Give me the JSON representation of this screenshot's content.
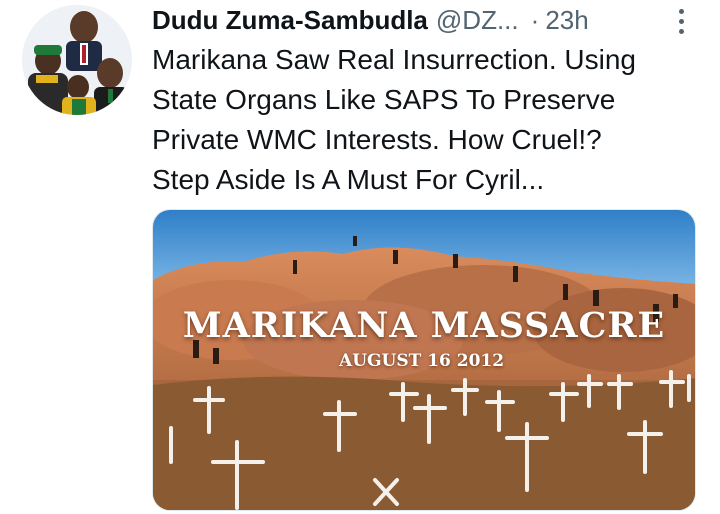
{
  "tweet": {
    "author": {
      "display_name": "Dudu Zuma-Sambudla",
      "handle": "@DZ...",
      "avatar_icon": "profile-avatar"
    },
    "separator": "·",
    "time": "23h",
    "more_icon": "more-vertical-icon",
    "text_lines": [
      "Marikana Saw Real Insurrection. Using",
      "State Organs Like SAPS To Preserve",
      "Private WMC Interests. How Cruel!?",
      "Step Aside Is A Must For Cyril..."
    ],
    "media": {
      "overlay_title": "MARIKANA MASSACRE",
      "overlay_subtitle": "AUGUST 16 2012"
    }
  },
  "colors": {
    "text_primary": "#0f1419",
    "text_secondary": "#536471",
    "sky": "#3f8fd1",
    "rock": "#c97a4f",
    "grass": "#8a5a32"
  }
}
